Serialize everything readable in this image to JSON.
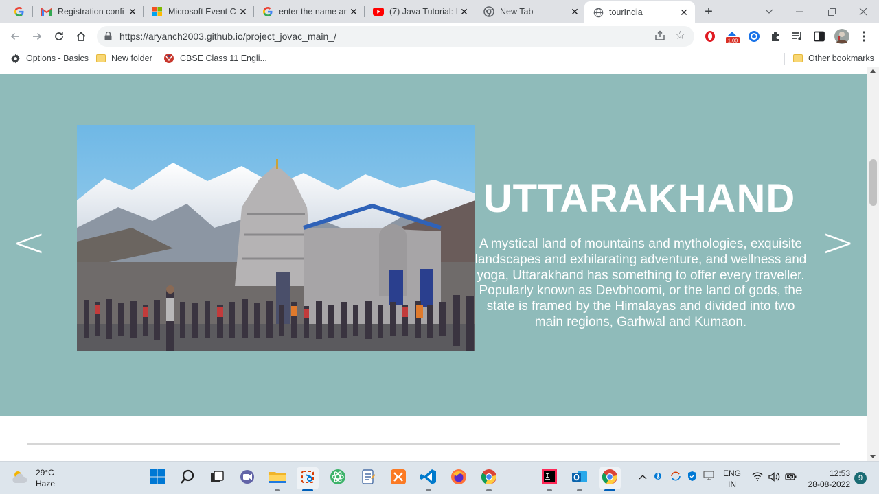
{
  "browser": {
    "tabs": [
      {
        "title": "",
        "icon": "google-icon"
      },
      {
        "title": "Registration confi",
        "icon": "gmail-icon"
      },
      {
        "title": "Microsoft Event C",
        "icon": "microsoft-icon"
      },
      {
        "title": "enter the name ar",
        "icon": "google-icon"
      },
      {
        "title": "(7) Java Tutorial: I",
        "icon": "youtube-icon"
      },
      {
        "title": "New Tab",
        "icon": "chrome-icon"
      },
      {
        "title": "tourIndia",
        "icon": "globe-icon",
        "active": true
      }
    ],
    "new_tab_glyph": "+",
    "url": "https://aryanch2003.github.io/project_jovac_main_/",
    "extension_badge": "1.00",
    "bookmarks": [
      {
        "label": "Options - Basics",
        "icon": "gear-icon"
      },
      {
        "label": "New folder",
        "icon": "folder-icon"
      },
      {
        "label": "CBSE Class 11 Engli...",
        "icon": "cbse-icon"
      }
    ],
    "other_bookmarks": "Other bookmarks"
  },
  "slide": {
    "title": "UTTARAKHAND",
    "description": "A mystical land of mountains and mythologies, exquisite landscapes and exhilarating adventure, and wellness and yoga, Uttarakhand has something to offer every traveller. Popularly known as Devbhoomi, or the land of gods, the state is framed by the Himalayas and divided into two main regions, Garhwal and Kumaon.",
    "prev": "<",
    "next": ">",
    "background": "#8fbbba"
  },
  "taskbar": {
    "weather_temp": "29°C",
    "weather_desc": "Haze",
    "lang_1": "ENG",
    "lang_2": "IN",
    "time": "12:53",
    "date": "28-08-2022",
    "notifications": "9"
  }
}
